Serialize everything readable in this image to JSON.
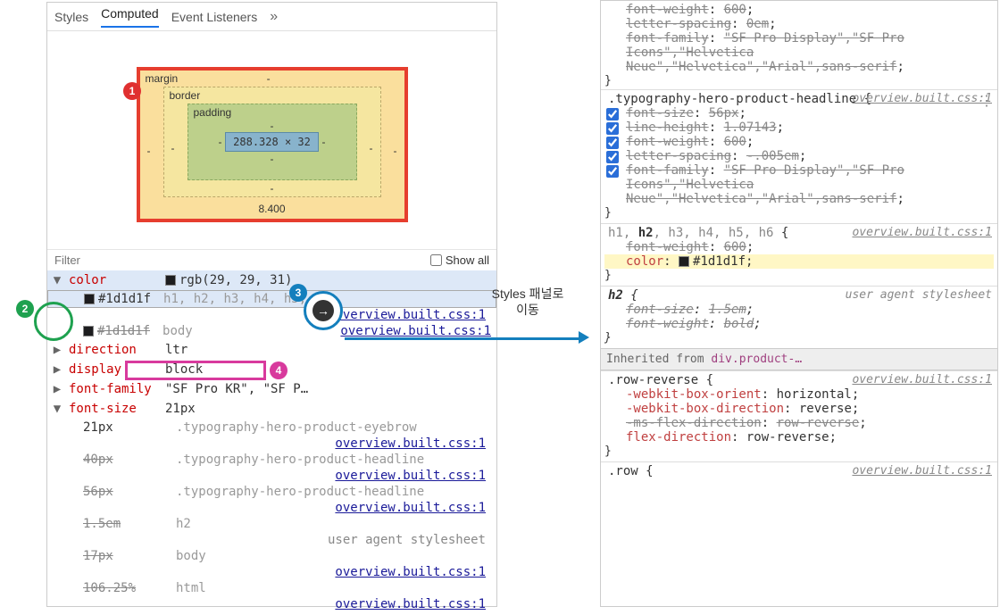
{
  "tabs": {
    "styles": "Styles",
    "computed": "Computed",
    "listeners": "Event Listeners",
    "more": "»"
  },
  "box_model": {
    "margin_label": "margin",
    "border_label": "border",
    "padding_label": "padding",
    "content": "288.328 × 32",
    "margin_bottom": "8.400",
    "dash": "-"
  },
  "filter": {
    "placeholder": "Filter",
    "show_all": "Show all"
  },
  "computed": {
    "color": {
      "name": "color",
      "value": "rgb(29, 29, 31)"
    },
    "color_row1": {
      "swatch_hex": "#1d1d1f",
      "sel": "h1, h2, h3, h4, h5, h6",
      "src": "overview.built.css:1"
    },
    "color_row2": {
      "swatch_hex": "#1d1d1f",
      "sel": "body",
      "src": "overview.built.css:1"
    },
    "direction": {
      "name": "direction",
      "value": "ltr"
    },
    "display": {
      "name": "display",
      "value": "block"
    },
    "font_family": {
      "name": "font-family",
      "value": "\"SF Pro KR\", \"SF P…"
    },
    "font_size": {
      "name": "font-size",
      "value": "21px"
    },
    "fs_rows": [
      {
        "val": "21px",
        "sel": ".typography-hero-product-eyebrow",
        "src": "overview.built.css:1"
      },
      {
        "val": "40px",
        "sel": ".typography-hero-product-headline",
        "src": "overview.built.css:1"
      },
      {
        "val": "56px",
        "sel": ".typography-hero-product-headline",
        "src": "overview.built.css:1"
      },
      {
        "val": "1.5em",
        "sel": "h2",
        "src": "user agent stylesheet"
      },
      {
        "val": "17px",
        "sel": "body",
        "src": "overview.built.css:1"
      },
      {
        "val": "106.25%",
        "sel": "html",
        "src": "overview.built.css:1"
      }
    ]
  },
  "center_label": "Styles 패널로\n이동",
  "styles": {
    "top_rule_decls": [
      {
        "p": "font-weight",
        "v": "600",
        "overr": true
      },
      {
        "p": "letter-spacing",
        "v": "0em",
        "overr": true
      },
      {
        "p": "font-family",
        "v": "\"SF Pro Display\",\"SF Pro Icons\",\"Helvetica Neue\",\"Helvetica\",\"Arial\",sans-serif",
        "overr": true
      }
    ],
    "close1": "}",
    "rule2_sel": ".typography-hero-product-headline",
    "rule2_src": "overview.built.css:1",
    "rule2_decls": [
      {
        "p": "font-size",
        "v": "56px",
        "chk": true,
        "overr": true
      },
      {
        "p": "line-height",
        "v": "1.07143",
        "chk": true,
        "overr": true
      },
      {
        "p": "font-weight",
        "v": "600",
        "chk": true,
        "overr": true
      },
      {
        "p": "letter-spacing",
        "v": "-.005em",
        "chk": true,
        "overr": true
      },
      {
        "p": "font-family",
        "v": "\"SF Pro Display\",\"SF Pro Icons\",\"Helvetica Neue\",\"Helvetica\",\"Arial\",sans-serif",
        "chk": true,
        "overr": true
      }
    ],
    "rule3_sel_parts": [
      "h1, ",
      "h2",
      ", h3, h4, h5, h6"
    ],
    "rule3_src": "overview.built.css:1",
    "rule3_decls": [
      {
        "p": "font-weight",
        "v": "600",
        "overr": true,
        "highlight": false
      },
      {
        "p": "color",
        "v": "#1d1d1f",
        "swatch": "#1d1d1f",
        "highlight": true
      }
    ],
    "rule4_sel": "h2",
    "rule4_src": "user agent stylesheet",
    "rule4_decls": [
      {
        "p": "font-size",
        "v": "1.5em",
        "overr": true
      },
      {
        "p": "font-weight",
        "v": "bold",
        "overr": true
      }
    ],
    "inherited_label": "Inherited from ",
    "inherited_link": "div.product-…",
    "rule5_sel": ".row-reverse",
    "rule5_src": "overview.built.css:1",
    "rule5_decls": [
      {
        "p": "-webkit-box-orient",
        "v": "horizontal"
      },
      {
        "p": "-webkit-box-direction",
        "v": "reverse"
      },
      {
        "p": "-ms-flex-direction",
        "v": "row-reverse",
        "overr": true
      },
      {
        "p": "flex-direction",
        "v": "row-reverse"
      }
    ],
    "rule6_sel": ".row",
    "rule6_src": "overview.built.css:1",
    "brace_open": " {",
    "brace_close": "}"
  },
  "ann": {
    "n1": "1",
    "n2": "2",
    "n3": "3",
    "n4": "4",
    "arrow": "→"
  }
}
